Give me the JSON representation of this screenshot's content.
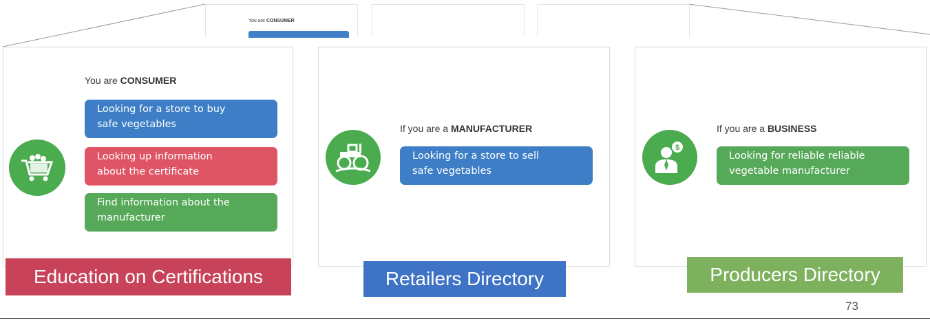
{
  "thumbnail": {
    "prefix": "You are",
    "role": "CONSUMER"
  },
  "consumer_panel": {
    "prefix": "You are",
    "role": "CONSUMER",
    "icon": "shopping-cart-vegetables-icon",
    "options": [
      {
        "line1": "Looking for a store to buy",
        "line2": "safe vegetables",
        "color": "#3d7ec6"
      },
      {
        "line1": "Looking up information",
        "line2": "about the certificate",
        "color": "#df5565"
      },
      {
        "line1": "Find information about the",
        "line2": "manufacturer",
        "color": "#57a95a"
      }
    ]
  },
  "manufacturer_panel": {
    "prefix": "If you are a",
    "role": "MANUFACTURER",
    "icon": "tractor-icon",
    "options": [
      {
        "line1": "Looking for a store to sell",
        "line2": "safe vegetables",
        "color": "#3d7ec6"
      }
    ]
  },
  "business_panel": {
    "prefix": "If you are a",
    "role": "BUSINESS",
    "icon": "businessman-money-icon",
    "options": [
      {
        "line1": "Looking for reliable reliable",
        "line2": "vegetable manufacturer",
        "color": "#57a95a"
      }
    ]
  },
  "labels": {
    "education": "Education on Certifications",
    "retailers": "Retailers Directory",
    "producers": "Producers Directory"
  },
  "colors": {
    "education": "#c8435a",
    "retailers": "#3e73c5",
    "producers": "#7eb15e",
    "icon_green": "#4aab4f"
  },
  "page_number": "73"
}
